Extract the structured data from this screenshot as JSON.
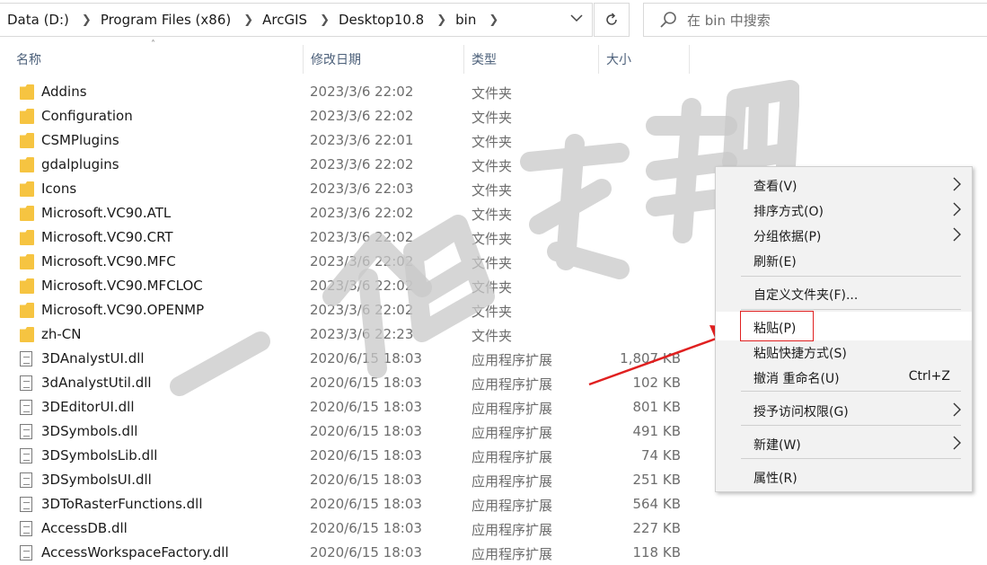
{
  "address": {
    "crumbs": [
      "Data (D:)",
      "Program Files (x86)",
      "ArcGIS",
      "Desktop10.8",
      "bin"
    ],
    "dropdown_icon": "chevron-down-icon",
    "refresh_icon": "refresh-icon"
  },
  "search": {
    "placeholder": "在 bin 中搜索"
  },
  "columns": {
    "name": "名称",
    "date": "修改日期",
    "type": "类型",
    "size": "大小"
  },
  "files": [
    {
      "name": "Addins",
      "date": "2023/3/6 22:02",
      "type": "文件夹",
      "size": "",
      "kind": "folder"
    },
    {
      "name": "Configuration",
      "date": "2023/3/6 22:02",
      "type": "文件夹",
      "size": "",
      "kind": "folder"
    },
    {
      "name": "CSMPlugins",
      "date": "2023/3/6 22:01",
      "type": "文件夹",
      "size": "",
      "kind": "folder"
    },
    {
      "name": "gdalplugins",
      "date": "2023/3/6 22:02",
      "type": "文件夹",
      "size": "",
      "kind": "folder"
    },
    {
      "name": "Icons",
      "date": "2023/3/6 22:03",
      "type": "文件夹",
      "size": "",
      "kind": "folder"
    },
    {
      "name": "Microsoft.VC90.ATL",
      "date": "2023/3/6 22:02",
      "type": "文件夹",
      "size": "",
      "kind": "folder"
    },
    {
      "name": "Microsoft.VC90.CRT",
      "date": "2023/3/6 22:02",
      "type": "文件夹",
      "size": "",
      "kind": "folder"
    },
    {
      "name": "Microsoft.VC90.MFC",
      "date": "2023/3/6 22:02",
      "type": "文件夹",
      "size": "",
      "kind": "folder"
    },
    {
      "name": "Microsoft.VC90.MFCLOC",
      "date": "2023/3/6 22:02",
      "type": "文件夹",
      "size": "",
      "kind": "folder"
    },
    {
      "name": "Microsoft.VC90.OPENMP",
      "date": "2023/3/6 22:02",
      "type": "文件夹",
      "size": "",
      "kind": "folder"
    },
    {
      "name": "zh-CN",
      "date": "2023/3/6 22:23",
      "type": "文件夹",
      "size": "",
      "kind": "folder"
    },
    {
      "name": "3DAnalystUI.dll",
      "date": "2020/6/15 18:03",
      "type": "应用程序扩展",
      "size": "1,807 KB",
      "kind": "file"
    },
    {
      "name": "3dAnalystUtil.dll",
      "date": "2020/6/15 18:03",
      "type": "应用程序扩展",
      "size": "102 KB",
      "kind": "file"
    },
    {
      "name": "3DEditorUI.dll",
      "date": "2020/6/15 18:03",
      "type": "应用程序扩展",
      "size": "801 KB",
      "kind": "file"
    },
    {
      "name": "3DSymbols.dll",
      "date": "2020/6/15 18:03",
      "type": "应用程序扩展",
      "size": "491 KB",
      "kind": "file"
    },
    {
      "name": "3DSymbolsLib.dll",
      "date": "2020/6/15 18:03",
      "type": "应用程序扩展",
      "size": "74 KB",
      "kind": "file"
    },
    {
      "name": "3DSymbolsUI.dll",
      "date": "2020/6/15 18:03",
      "type": "应用程序扩展",
      "size": "251 KB",
      "kind": "file"
    },
    {
      "name": "3DToRasterFunctions.dll",
      "date": "2020/6/15 18:03",
      "type": "应用程序扩展",
      "size": "564 KB",
      "kind": "file"
    },
    {
      "name": "AccessDB.dll",
      "date": "2020/6/15 18:03",
      "type": "应用程序扩展",
      "size": "227 KB",
      "kind": "file"
    },
    {
      "name": "AccessWorkspaceFactory.dll",
      "date": "2020/6/15 18:03",
      "type": "应用程序扩展",
      "size": "118 KB",
      "kind": "file"
    }
  ],
  "context_menu": {
    "items": [
      {
        "label": "查看(V)",
        "shortcut": "",
        "submenu": true
      },
      {
        "label": "排序方式(O)",
        "shortcut": "",
        "submenu": true
      },
      {
        "label": "分组依据(P)",
        "shortcut": "",
        "submenu": true
      },
      {
        "label": "刷新(E)",
        "shortcut": "",
        "submenu": false
      },
      {
        "label": "自定义文件夹(F)...",
        "shortcut": "",
        "submenu": false
      },
      {
        "label": "粘贴(P)",
        "shortcut": "",
        "submenu": false,
        "highlighted": true
      },
      {
        "label": "粘贴快捷方式(S)",
        "shortcut": "",
        "submenu": false
      },
      {
        "label": "撤消 重命名(U)",
        "shortcut": "Ctrl+Z",
        "submenu": false
      },
      {
        "label": "授予访问权限(G)",
        "shortcut": "",
        "submenu": true
      },
      {
        "label": "新建(W)",
        "shortcut": "",
        "submenu": true
      },
      {
        "label": "属性(R)",
        "shortcut": "",
        "submenu": false
      }
    ]
  },
  "watermark": "一个白衣书生",
  "colors": {
    "folder": "#f6c441",
    "annotation": "#e02020",
    "header_text": "#4c607a"
  }
}
